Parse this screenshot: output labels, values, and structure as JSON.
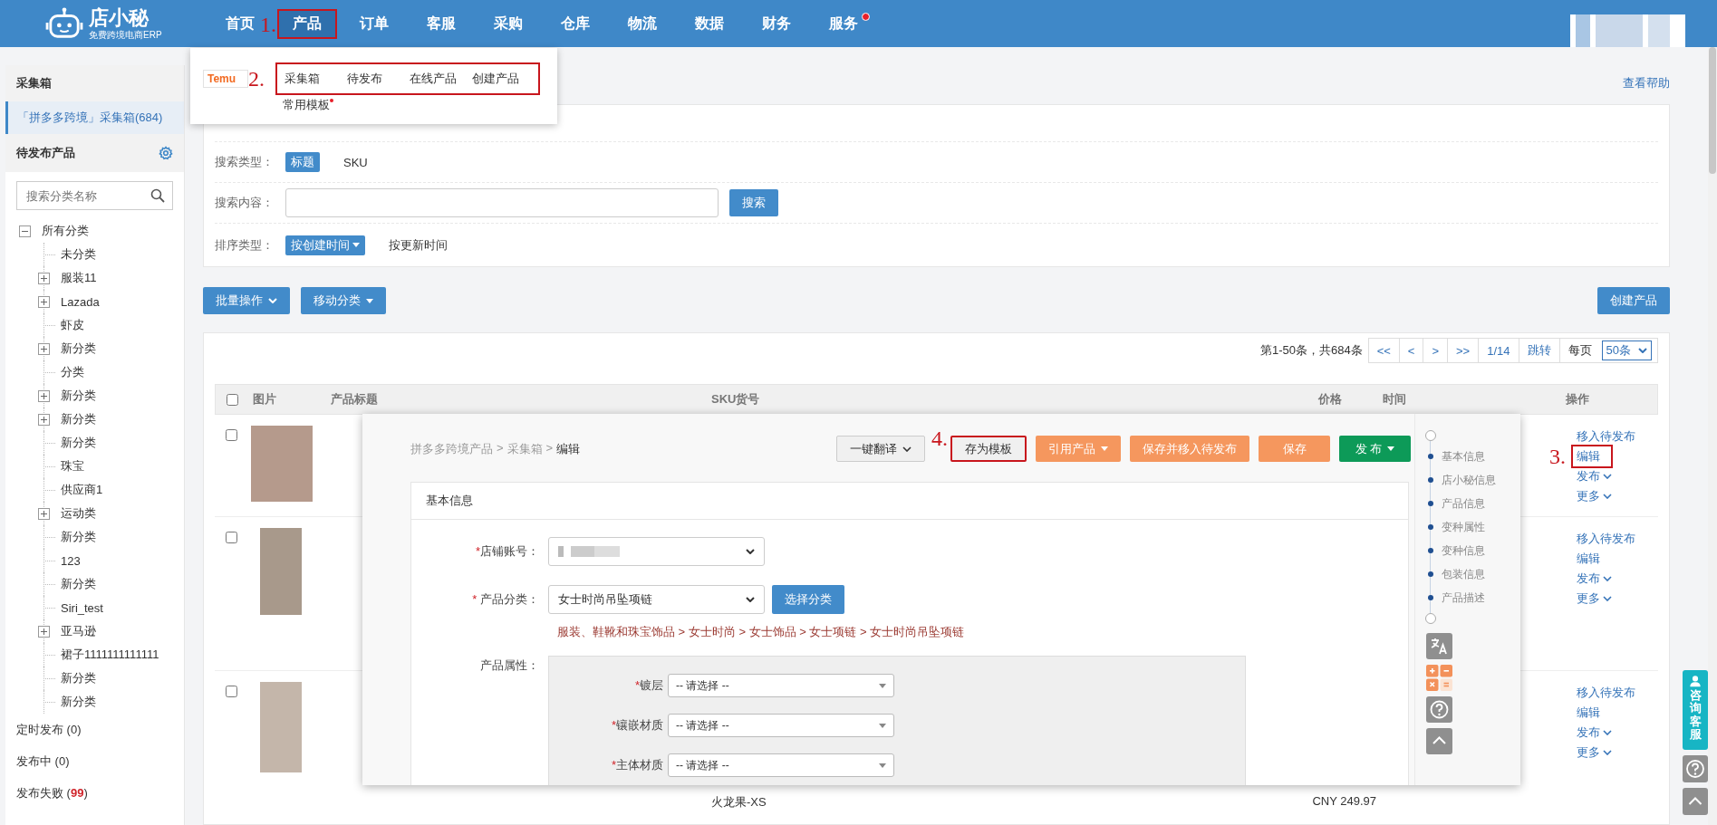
{
  "header": {
    "logo_title": "店小秘",
    "logo_subtitle": "免费跨境电商ERP",
    "nav": [
      {
        "label": "首页",
        "selected": false,
        "dot": false
      },
      {
        "label": "产品",
        "selected": true,
        "dot": false,
        "annotation": "1."
      },
      {
        "label": "订单",
        "selected": false,
        "dot": false
      },
      {
        "label": "客服",
        "selected": false,
        "dot": false
      },
      {
        "label": "采购",
        "selected": false,
        "dot": false
      },
      {
        "label": "仓库",
        "selected": false,
        "dot": false
      },
      {
        "label": "物流",
        "selected": false,
        "dot": false
      },
      {
        "label": "数据",
        "selected": false,
        "dot": false
      },
      {
        "label": "财务",
        "selected": false,
        "dot": false
      },
      {
        "label": "服务",
        "selected": false,
        "dot": true
      }
    ]
  },
  "product_menu": {
    "platform": "Temu",
    "annotation": "2.",
    "items": [
      "采集箱",
      "待发布",
      "在线产品",
      "创建产品"
    ],
    "more_items": [
      {
        "label": "常用模板",
        "dot": true
      }
    ]
  },
  "sidebar": {
    "collect_title": "采集箱",
    "collect_items": [
      {
        "label": "「拼多多跨境」采集箱(684)",
        "selected": true
      }
    ],
    "pending_title": "待发布产品",
    "search": {
      "placeholder": "搜索分类名称"
    },
    "tree": [
      {
        "label": "所有分类",
        "expanded": true,
        "children": [
          {
            "label": "未分类"
          },
          {
            "label": "服装11",
            "expanded": false
          },
          {
            "label": "Lazada",
            "expanded": false
          },
          {
            "label": "虾皮"
          },
          {
            "label": "新分类",
            "expanded": false
          },
          {
            "label": "分类"
          },
          {
            "label": "新分类",
            "expanded": false
          },
          {
            "label": "新分类",
            "expanded": false
          },
          {
            "label": "新分类"
          },
          {
            "label": "珠宝"
          },
          {
            "label": "供应商1"
          },
          {
            "label": "运动类",
            "expanded": false
          },
          {
            "label": "新分类"
          },
          {
            "label": "123"
          },
          {
            "label": "新分类"
          },
          {
            "label": "Siri_test"
          },
          {
            "label": "亚马逊",
            "expanded": false
          },
          {
            "label": "裙子1111111111111"
          },
          {
            "label": "新分类"
          },
          {
            "label": "新分类"
          }
        ]
      }
    ],
    "status_items": [
      "定时发布 (0)",
      "发布中 (0)",
      "发布失败 (**99**)"
    ]
  },
  "help_link": "查看帮助",
  "filters": [
    {
      "label": "搜索类型：",
      "kind": "options",
      "options": [
        {
          "label": "标题",
          "selected": true,
          "dropdown": false
        },
        {
          "label": "SKU",
          "selected": false,
          "dropdown": false
        }
      ]
    },
    {
      "label": "搜索内容：",
      "kind": "search",
      "button": "搜索"
    },
    {
      "label": "排序类型：",
      "kind": "options",
      "options": [
        {
          "label": "按创建时间",
          "selected": true,
          "dropdown": true
        },
        {
          "label": "按更新时间",
          "selected": false,
          "dropdown": false
        }
      ]
    }
  ],
  "toolbar": {
    "left": [
      {
        "label": "批量操作",
        "kind": "chevron"
      },
      {
        "label": "移动分类",
        "kind": "caret"
      }
    ],
    "right": [
      {
        "label": "创建产品"
      }
    ]
  },
  "pagination": {
    "summary": "第1-50条，共684条",
    "buttons": [
      "<<",
      "<",
      ">",
      ">>"
    ],
    "page": "1/14",
    "jump": "跳转",
    "per_page_label": "每页",
    "per_page": "50条"
  },
  "table": {
    "select_all_checked": false,
    "columns": [
      "图片",
      "产品标题",
      "SKU货号",
      "价格",
      "时间",
      "操作"
    ],
    "rows": [
      {
        "checked": false,
        "actions": [
          {
            "label": "移入待发布",
            "kind": "link"
          },
          {
            "label": "编辑",
            "kind": "link",
            "annotation": "3."
          },
          {
            "label": "发布",
            "kind": "menu"
          },
          {
            "label": "更多",
            "kind": "menu"
          }
        ]
      },
      {
        "checked": false,
        "actions": [
          {
            "label": "移入待发布",
            "kind": "link"
          },
          {
            "label": "编辑",
            "kind": "link"
          },
          {
            "label": "发布",
            "kind": "menu"
          },
          {
            "label": "更多",
            "kind": "menu"
          }
        ]
      },
      {
        "checked": false,
        "sku": "火龙果-XS",
        "price": "CNY 249.97",
        "actions": [
          {
            "label": "移入待发布",
            "kind": "link"
          },
          {
            "label": "编辑",
            "kind": "link"
          },
          {
            "label": "发布",
            "kind": "menu"
          },
          {
            "label": "更多",
            "kind": "menu"
          }
        ]
      }
    ]
  },
  "editor": {
    "breadcrumb": {
      "items": [
        "拼多多跨境产品",
        "采集箱",
        "编辑"
      ],
      "separator": ">"
    },
    "buttons": [
      {
        "label": "一键翻译",
        "kind": "default",
        "dropdown": true
      },
      {
        "label": "存为模板",
        "kind": "default",
        "dropdown": false,
        "annotation": "4."
      },
      {
        "label": "引用产品",
        "kind": "warning",
        "dropdown": true
      },
      {
        "label": "保存并移入待发布",
        "kind": "warning",
        "dropdown": false
      },
      {
        "label": "保存",
        "kind": "warning",
        "dropdown": false
      },
      {
        "label": "发 布",
        "kind": "success",
        "dropdown": true
      }
    ],
    "panel_title": "基本信息",
    "fields": [
      {
        "mark": "*",
        "label": "店铺账号：",
        "kind": "select",
        "redacted": true
      },
      {
        "mark": "* ",
        "label": "产品分类：",
        "kind": "select",
        "value": "女士时尚吊坠项链",
        "button": "选择分类",
        "path": "服装、鞋靴和珠宝饰品 > 女士时尚 > 女士饰品 > 女士项链 > 女士时尚吊坠项链"
      },
      {
        "label": "产品属性：",
        "kind": "group",
        "attributes": [
          {
            "mark": "*",
            "label": "镀层",
            "value": "-- 请选择 --"
          },
          {
            "mark": "*",
            "label": "镶嵌材质",
            "value": "-- 请选择 --"
          },
          {
            "mark": "*",
            "label": "主体材质",
            "value": "-- 请选择 --"
          }
        ]
      }
    ],
    "sections": [
      "基本信息",
      "店小秘信息",
      "产品信息",
      "变种属性",
      "变种信息",
      "包装信息",
      "产品描述"
    ]
  },
  "service_button": "咨询客服"
}
